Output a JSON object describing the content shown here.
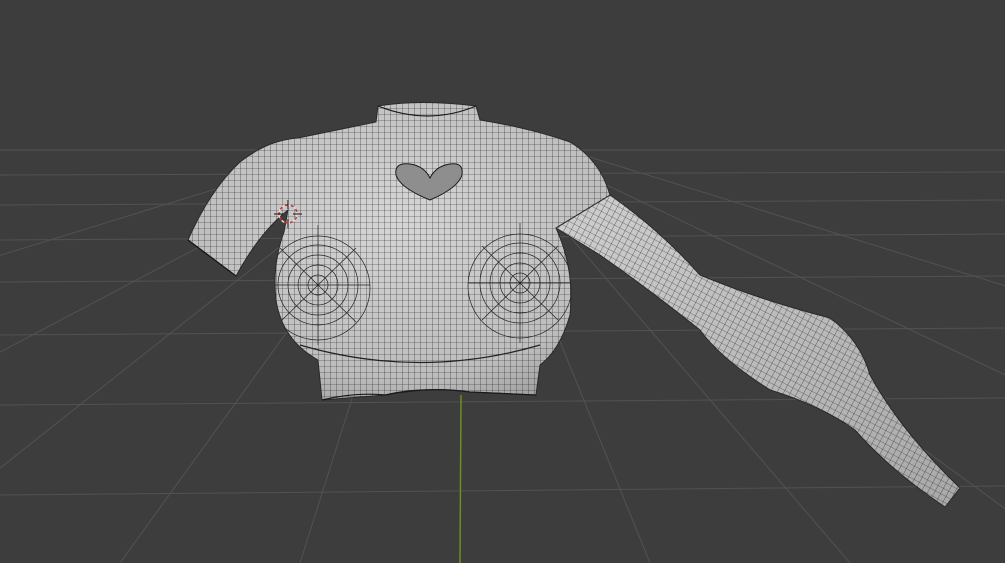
{
  "viewport": {
    "background": "#3d3d3d",
    "grid_color": "#525252",
    "y_axis_color": "#6b8f22",
    "mesh_fill": "#c8c8c8",
    "mesh_shadow": "#8f8f8f",
    "wire_color": "#1f1f1f",
    "cursor_colors": [
      "#e0e0e0",
      "#d03030"
    ]
  },
  "icons": {
    "3d_cursor": "3d-cursor-icon"
  }
}
